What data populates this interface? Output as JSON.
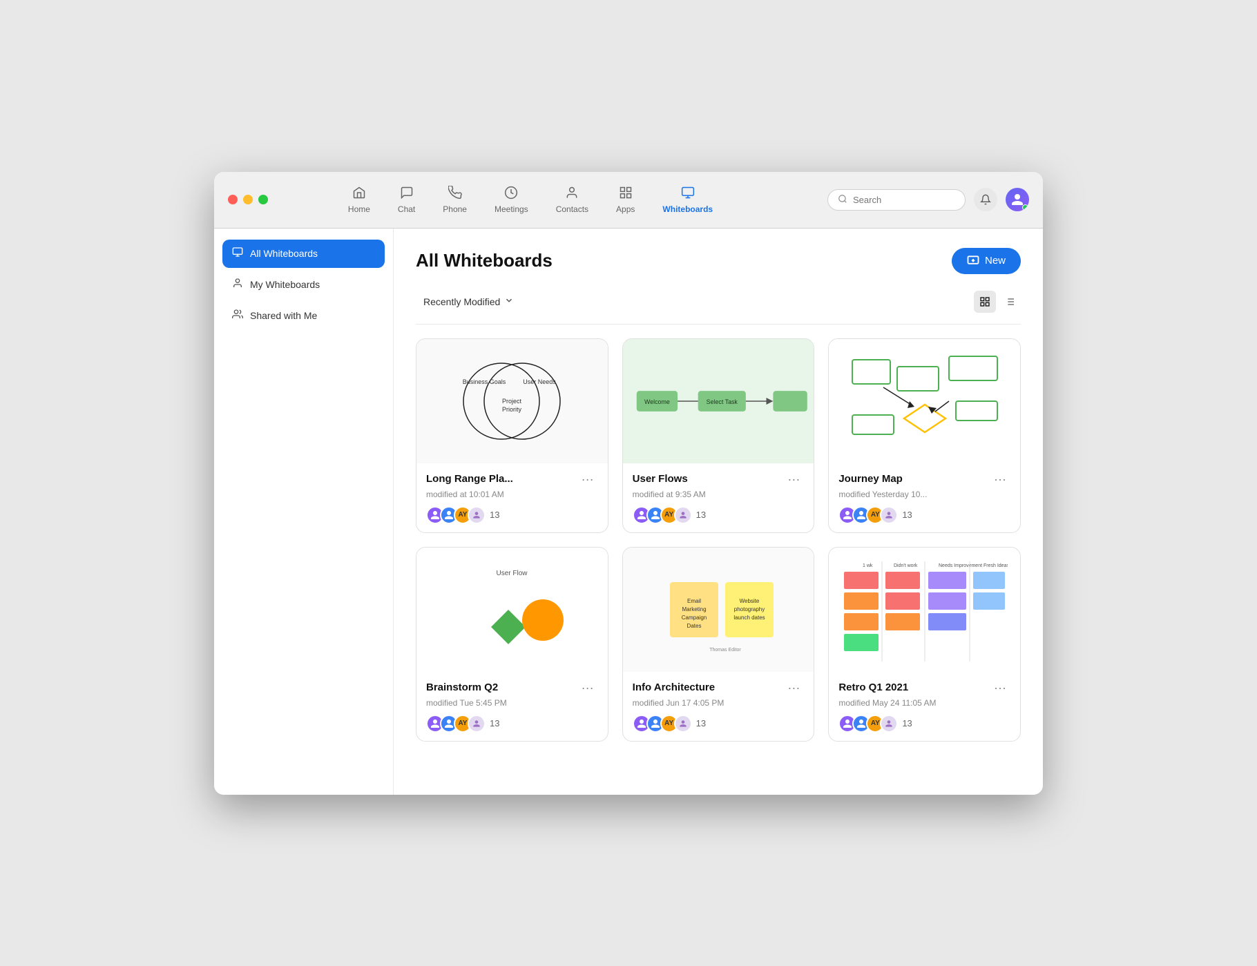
{
  "window": {
    "title": "Whiteboards"
  },
  "titlebar": {
    "traffic_lights": [
      "red",
      "yellow",
      "green"
    ],
    "nav_tabs": [
      {
        "id": "home",
        "label": "Home",
        "icon": "⌂",
        "active": false
      },
      {
        "id": "chat",
        "label": "Chat",
        "icon": "💬",
        "active": false
      },
      {
        "id": "phone",
        "label": "Phone",
        "icon": "📞",
        "active": false
      },
      {
        "id": "meetings",
        "label": "Meetings",
        "icon": "🕐",
        "active": false
      },
      {
        "id": "contacts",
        "label": "Contacts",
        "icon": "👤",
        "active": false
      },
      {
        "id": "apps",
        "label": "Apps",
        "icon": "⊞",
        "active": false
      },
      {
        "id": "whiteboards",
        "label": "Whiteboards",
        "icon": "🖥",
        "active": true
      }
    ],
    "search": {
      "placeholder": "Search"
    }
  },
  "sidebar": {
    "items": [
      {
        "id": "all",
        "label": "All Whiteboards",
        "icon": "▭",
        "active": true
      },
      {
        "id": "my",
        "label": "My Whiteboards",
        "icon": "👤",
        "active": false
      },
      {
        "id": "shared",
        "label": "Shared with Me",
        "icon": "👥",
        "active": false
      }
    ]
  },
  "content": {
    "title": "All Whiteboards",
    "new_button": "New",
    "sort_label": "Recently Modified",
    "whiteboards": [
      {
        "id": "1",
        "title": "Long Range Pla...",
        "modified": "modified at 10:01 AM",
        "collaborators_count": "13",
        "type": "venn"
      },
      {
        "id": "2",
        "title": "User Flows",
        "modified": "modified at 9:35 AM",
        "collaborators_count": "13",
        "type": "flow"
      },
      {
        "id": "3",
        "title": "Journey Map",
        "modified": "modified Yesterday 10...",
        "collaborators_count": "13",
        "type": "journey"
      },
      {
        "id": "4",
        "title": "Brainstorm Q2",
        "modified": "modified Tue 5:45 PM",
        "collaborators_count": "13",
        "type": "brainstorm"
      },
      {
        "id": "5",
        "title": "Info Architecture",
        "modified": "modified Jun 17 4:05 PM",
        "collaborators_count": "13",
        "type": "infoarch"
      },
      {
        "id": "6",
        "title": "Retro Q1 2021",
        "modified": "modified May 24 11:05 AM",
        "collaborators_count": "13",
        "type": "retro"
      }
    ]
  }
}
